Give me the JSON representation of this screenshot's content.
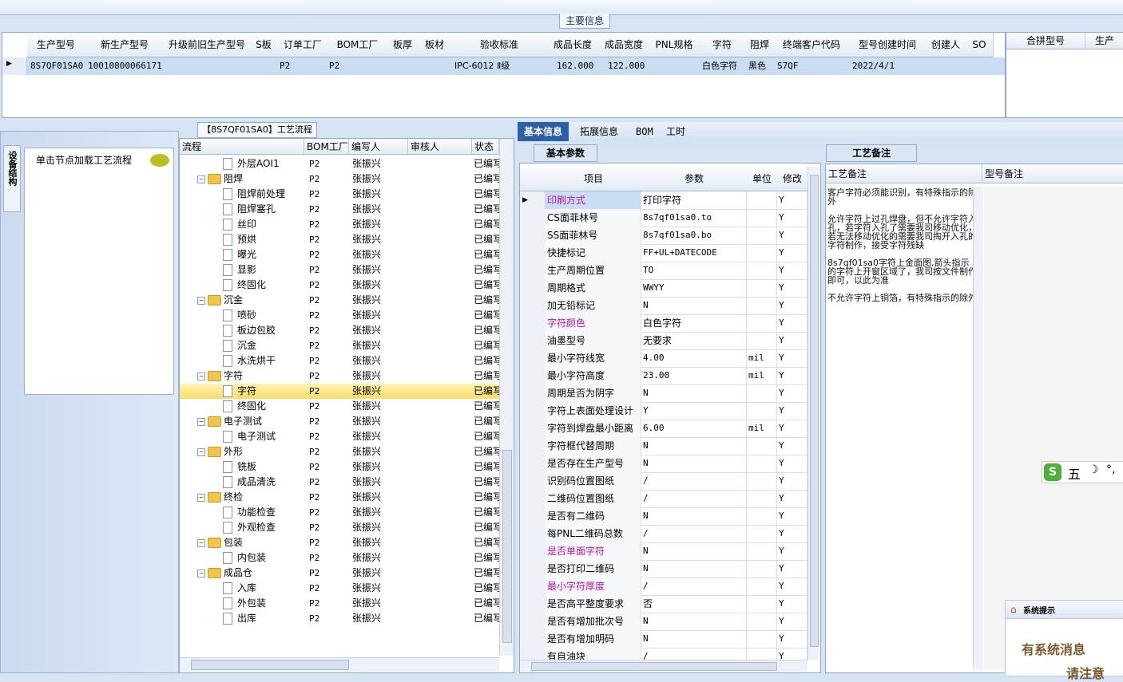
{
  "main_info": {
    "section_title": "主要信息",
    "columns": [
      "生产型号",
      "新生产型号",
      "升级前旧生产型号",
      "S板",
      "订单工厂",
      "BOM工厂",
      "板厚",
      "板材",
      "验收标准",
      "成品长度",
      "成品宽度",
      "PNL规格",
      "字符",
      "阻焊",
      "终端客户代码",
      "型号创建时间",
      "创建人",
      "SO"
    ],
    "row": {
      "生产型号": "8S7QF01SA0",
      "新生产型号": "10010800066171",
      "订单工厂": "P2",
      "BOM工厂": "P2",
      "验收标准": "IPC-6012 Ⅱ级",
      "成品长度": "162.000",
      "成品宽度": "122.000",
      "字符": "白色字符",
      "阻焊": "黑色",
      "终端客户代码": "S7QF",
      "型号创建时间": "2022/4/1"
    },
    "merge_columns": [
      "合拼型号",
      "生产"
    ]
  },
  "left": {
    "side_tab": "设备结构",
    "load_hint": "单击节点加载工艺流程"
  },
  "flow": {
    "title": "【8S7QF01SA0】工艺流程",
    "columns": [
      "流程",
      "BOM工厂",
      "编写人",
      "审核人",
      "状态"
    ],
    "rows": [
      {
        "name": "外层AOI1",
        "level": 1,
        "bom": "P2",
        "writer": "张振兴",
        "status": "已编写"
      },
      {
        "name": "阻焊",
        "level": 0,
        "bom": "P2",
        "writer": "张振兴",
        "status": "已编写"
      },
      {
        "name": "阻焊前处理",
        "level": 1,
        "bom": "P2",
        "writer": "张振兴",
        "status": "已编写"
      },
      {
        "name": "阻焊塞孔",
        "level": 1,
        "bom": "P2",
        "writer": "张振兴",
        "status": "已编写"
      },
      {
        "name": "丝印",
        "level": 1,
        "bom": "P2",
        "writer": "张振兴",
        "status": "已编写"
      },
      {
        "name": "预烘",
        "level": 1,
        "bom": "P2",
        "writer": "张振兴",
        "status": "已编写"
      },
      {
        "name": "曝光",
        "level": 1,
        "bom": "P2",
        "writer": "张振兴",
        "status": "已编写"
      },
      {
        "name": "显影",
        "level": 1,
        "bom": "P2",
        "writer": "张振兴",
        "status": "已编写"
      },
      {
        "name": "终固化",
        "level": 1,
        "bom": "P2",
        "writer": "张振兴",
        "status": "已编写"
      },
      {
        "name": "沉金",
        "level": 0,
        "bom": "P2",
        "writer": "张振兴",
        "status": "已编写"
      },
      {
        "name": "喷砂",
        "level": 1,
        "bom": "P2",
        "writer": "张振兴",
        "status": "已编写"
      },
      {
        "name": "板边包胶",
        "level": 1,
        "bom": "P2",
        "writer": "张振兴",
        "status": "已编写"
      },
      {
        "name": "沉金",
        "level": 1,
        "bom": "P2",
        "writer": "张振兴",
        "status": "已编写"
      },
      {
        "name": "水洗烘干",
        "level": 1,
        "bom": "P2",
        "writer": "张振兴",
        "status": "已编写"
      },
      {
        "name": "字符",
        "level": 0,
        "bom": "P2",
        "writer": "张振兴",
        "status": "已编写"
      },
      {
        "name": "字符",
        "level": 1,
        "bom": "P2",
        "writer": "张振兴",
        "status": "已编写",
        "selected": true
      },
      {
        "name": "终固化",
        "level": 1,
        "bom": "P2",
        "writer": "张振兴",
        "status": "已编写"
      },
      {
        "name": "电子测试",
        "level": 0,
        "bom": "P2",
        "writer": "张振兴",
        "status": "已编写"
      },
      {
        "name": "电子测试",
        "level": 1,
        "bom": "P2",
        "writer": "张振兴",
        "status": "已编写"
      },
      {
        "name": "外形",
        "level": 0,
        "bom": "P2",
        "writer": "张振兴",
        "status": "已编写"
      },
      {
        "name": "铣板",
        "level": 1,
        "bom": "P2",
        "writer": "张振兴",
        "status": "已编写"
      },
      {
        "name": "成品清洗",
        "level": 1,
        "bom": "P2",
        "writer": "张振兴",
        "status": "已编写"
      },
      {
        "name": "终检",
        "level": 0,
        "bom": "P2",
        "writer": "张振兴",
        "status": "已编写"
      },
      {
        "name": "功能检查",
        "level": 1,
        "bom": "P2",
        "writer": "张振兴",
        "status": "已编写"
      },
      {
        "name": "外观检查",
        "level": 1,
        "bom": "P2",
        "writer": "张振兴",
        "status": "已编写"
      },
      {
        "name": "包装",
        "level": 0,
        "bom": "P2",
        "writer": "张振兴",
        "status": "已编写"
      },
      {
        "name": "内包装",
        "level": 1,
        "bom": "P2",
        "writer": "张振兴",
        "status": "已编写"
      },
      {
        "name": "成品仓",
        "level": 0,
        "bom": "P2",
        "writer": "张振兴",
        "status": "已编写"
      },
      {
        "name": "入库",
        "level": 1,
        "bom": "P2",
        "writer": "张振兴",
        "status": "已编写"
      },
      {
        "name": "外包装",
        "level": 1,
        "bom": "P2",
        "writer": "张振兴",
        "status": "已编写"
      },
      {
        "name": "出库",
        "level": 1,
        "bom": "P2",
        "writer": "张振兴",
        "status": "已编写"
      }
    ]
  },
  "right_tabs": [
    "基本信息",
    "拓展信息",
    "BOM",
    "工时"
  ],
  "basic": {
    "title": "基本参数",
    "columns": [
      "项目",
      "参数",
      "单位",
      "修改"
    ],
    "rows": [
      {
        "item": "印刷方式",
        "value": "打印字符",
        "unit": "",
        "mod": "Y",
        "purple": true,
        "selected": true
      },
      {
        "item": "CS面菲林号",
        "value": "8s7qf01sa0.to",
        "unit": "",
        "mod": "Y"
      },
      {
        "item": "SS面菲林号",
        "value": "8s7qf01sa0.bo",
        "unit": "",
        "mod": "Y"
      },
      {
        "item": "快捷标记",
        "value": "FF+UL+DATECODE",
        "unit": "",
        "mod": "Y"
      },
      {
        "item": "生产周期位置",
        "value": "TO",
        "unit": "",
        "mod": "Y"
      },
      {
        "item": "周期格式",
        "value": "WWYY",
        "unit": "",
        "mod": "Y"
      },
      {
        "item": "加无铅标记",
        "value": "N",
        "unit": "",
        "mod": "Y"
      },
      {
        "item": "字符颜色",
        "value": "白色字符",
        "unit": "",
        "mod": "Y",
        "purple": true
      },
      {
        "item": "油墨型号",
        "value": "无要求",
        "unit": "",
        "mod": "Y"
      },
      {
        "item": "最小字符线宽",
        "value": "4.00",
        "unit": "mil",
        "mod": "Y"
      },
      {
        "item": "最小字符高度",
        "value": "23.00",
        "unit": "mil",
        "mod": "Y"
      },
      {
        "item": "周期是否为阴字",
        "value": "N",
        "unit": "",
        "mod": "Y"
      },
      {
        "item": "字符上表面处理设计",
        "value": "Y",
        "unit": "",
        "mod": "Y"
      },
      {
        "item": "字符到焊盘最小距离",
        "value": "6.00",
        "unit": "mil",
        "mod": "Y"
      },
      {
        "item": "字符框代替周期",
        "value": "N",
        "unit": "",
        "mod": "Y"
      },
      {
        "item": "是否存在生产型号",
        "value": "N",
        "unit": "",
        "mod": "Y"
      },
      {
        "item": "识别码位置图纸",
        "value": "/",
        "unit": "",
        "mod": "Y"
      },
      {
        "item": "二维码位置图纸",
        "value": "/",
        "unit": "",
        "mod": "Y"
      },
      {
        "item": "是否有二维码",
        "value": "N",
        "unit": "",
        "mod": "Y"
      },
      {
        "item": "每PNL二维码总数",
        "value": "/",
        "unit": "",
        "mod": "Y"
      },
      {
        "item": "是否单面字符",
        "value": "N",
        "unit": "",
        "mod": "Y",
        "purple": true
      },
      {
        "item": "是否打印二维码",
        "value": "N",
        "unit": "",
        "mod": "Y"
      },
      {
        "item": "最小字符厚度",
        "value": "/",
        "unit": "",
        "mod": "Y",
        "purple": true
      },
      {
        "item": "是否高平整度要求",
        "value": "否",
        "unit": "",
        "mod": "Y"
      },
      {
        "item": "是否有增加批次号",
        "value": "N",
        "unit": "",
        "mod": "Y"
      },
      {
        "item": "是否有增加明码",
        "value": "N",
        "unit": "",
        "mod": "Y"
      },
      {
        "item": "有自油块",
        "value": "/",
        "unit": "",
        "mod": "Y"
      }
    ]
  },
  "remark": {
    "title": "工艺备注",
    "col1": "工艺备注",
    "col2": "型号备注",
    "text": "客户字符必须能识别，有特殊指示的除外\n\n允许字符上过孔焊盘，但不允许字符入孔，若字符入孔了需要我司移动优化，若无法移动优化的需要我司掏开入孔的字符制作，接受字符残缺\n\n8s7qf01sa0字符上金面图,箭头指示的字符上开窗区域了，我司按文件制作即可，以此为准\n\n不允许字符上铜箔，有特殊指示的除外"
  },
  "ime": {
    "label": "五"
  },
  "sys_msg": {
    "title": "系统提示",
    "line1": "有系统消息",
    "line2": "请注意"
  },
  "colors": {
    "accent": "#2b5fa8",
    "selected_row": "#c9ddf3",
    "tree_selected": "#f8dd6a",
    "purple_label": "#b5169e"
  }
}
